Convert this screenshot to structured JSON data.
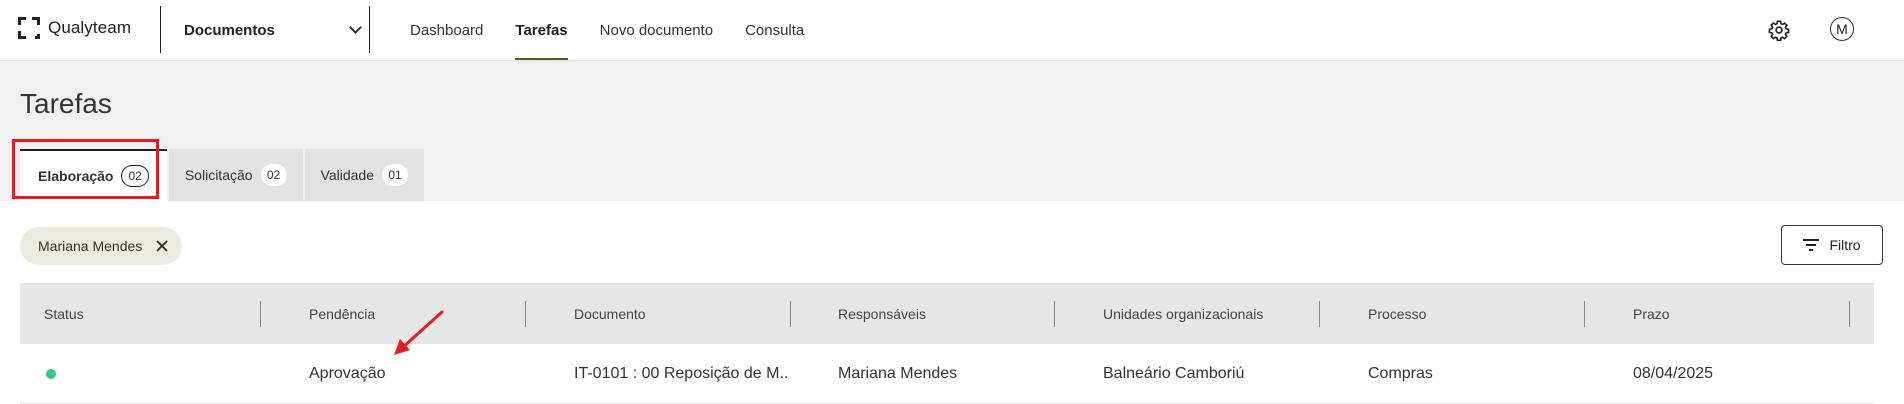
{
  "app": {
    "brand": "Qualyteam",
    "module": "Documentos"
  },
  "nav": [
    {
      "label": "Dashboard",
      "active": false
    },
    {
      "label": "Tarefas",
      "active": true
    },
    {
      "label": "Novo documento",
      "active": false
    },
    {
      "label": "Consulta",
      "active": false
    }
  ],
  "user": {
    "avatar_initial": "M"
  },
  "page": {
    "title": "Tarefas"
  },
  "tabs": [
    {
      "label": "Elaboração",
      "count": "02",
      "active": true
    },
    {
      "label": "Solicitação",
      "count": "02",
      "active": false
    },
    {
      "label": "Validade",
      "count": "01",
      "active": false
    }
  ],
  "filters": {
    "chip_label": "Mariana Mendes",
    "filter_button": "Filtro"
  },
  "table": {
    "columns": [
      "Status",
      "Pendência",
      "Documento",
      "Responsáveis",
      "Unidades organizacionais",
      "Processo",
      "Prazo"
    ],
    "rows": [
      {
        "status_color": "#35c98a",
        "pendencia": "Aprovação",
        "documento": "IT-0101 : 00 Reposição de M...",
        "responsaveis": "Mariana Mendes",
        "unidades": "Balneário Camboriú",
        "processo": "Compras",
        "prazo": "08/04/2025"
      }
    ]
  },
  "colors": {
    "accent": "#5a5a2a",
    "annotation": "#e02020",
    "status_ok": "#35c98a"
  },
  "icons": [
    "logo-icon",
    "chevron-down-icon",
    "gear-icon",
    "close-icon",
    "filter-icon",
    "status-dot-icon",
    "annotation-arrow-icon"
  ]
}
